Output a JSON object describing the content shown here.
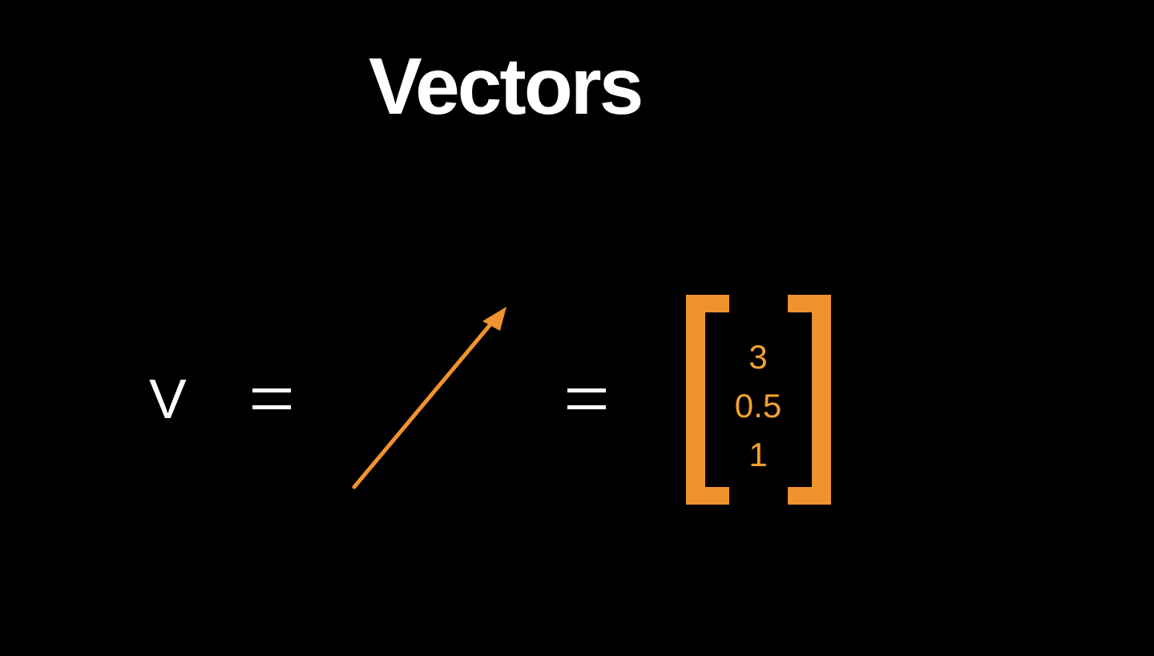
{
  "slide": {
    "title": "Vectors",
    "variable": "V",
    "equals_symbol": "=",
    "vector_entries": [
      "3",
      "0.5",
      "1"
    ]
  },
  "colors": {
    "background": "#000000",
    "text": "#ffffff",
    "accent": "#f0922e",
    "entry_text": "#f0a030"
  },
  "icons": {
    "arrow": "arrow-up-right-icon",
    "bracket_left": "left-bracket",
    "bracket_right": "right-bracket"
  }
}
